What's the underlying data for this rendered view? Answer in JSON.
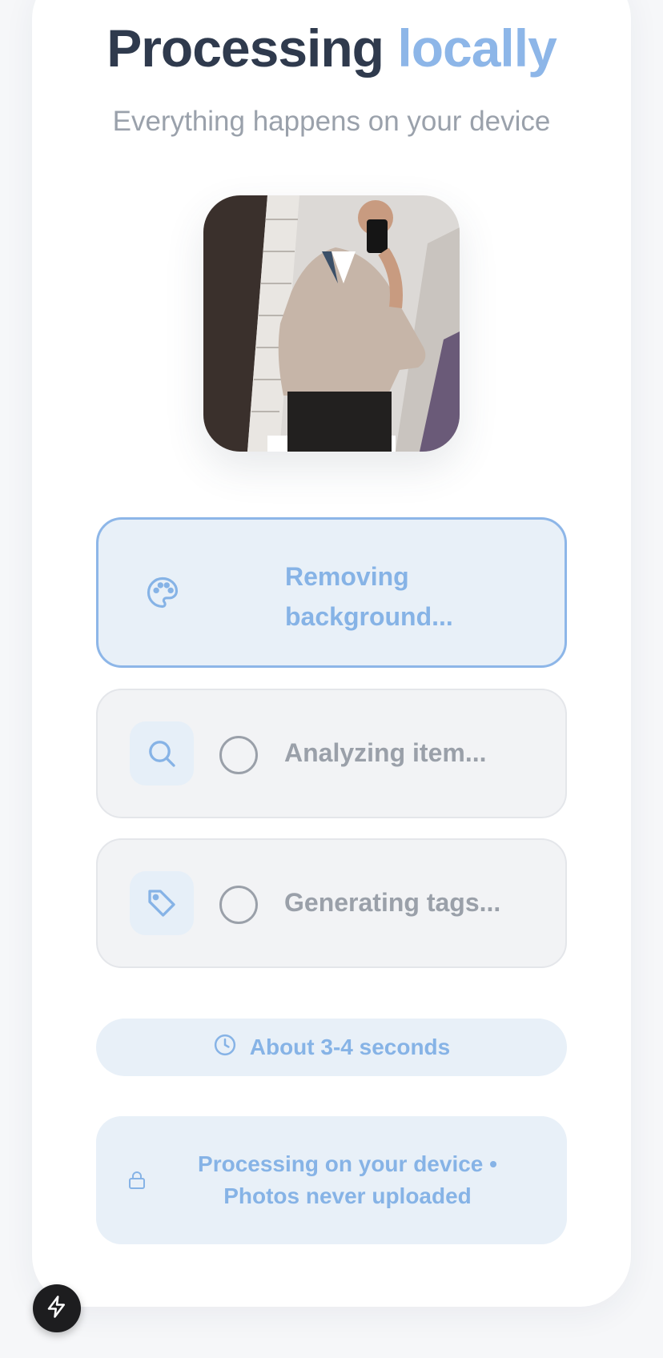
{
  "header": {
    "title_main": "Processing",
    "title_accent": "locally",
    "subtitle": "Everything happens on your device"
  },
  "steps": [
    {
      "label": "Removing background...",
      "icon": "palette-icon",
      "state": "active"
    },
    {
      "label": "Analyzing item...",
      "icon": "search-icon",
      "state": "pending"
    },
    {
      "label": "Generating tags...",
      "icon": "tag-icon",
      "state": "pending"
    }
  ],
  "eta": {
    "label": "About 3-4 seconds",
    "icon": "clock-icon"
  },
  "privacy": {
    "text": "Processing on your device • Photos never uploaded",
    "icon": "lock-icon"
  },
  "fab": {
    "icon": "lightning-icon"
  },
  "colors": {
    "accent": "#8db6e8",
    "title": "#2f3a4d",
    "muted": "#9aa0a9",
    "panel": "#e8f0f8"
  }
}
